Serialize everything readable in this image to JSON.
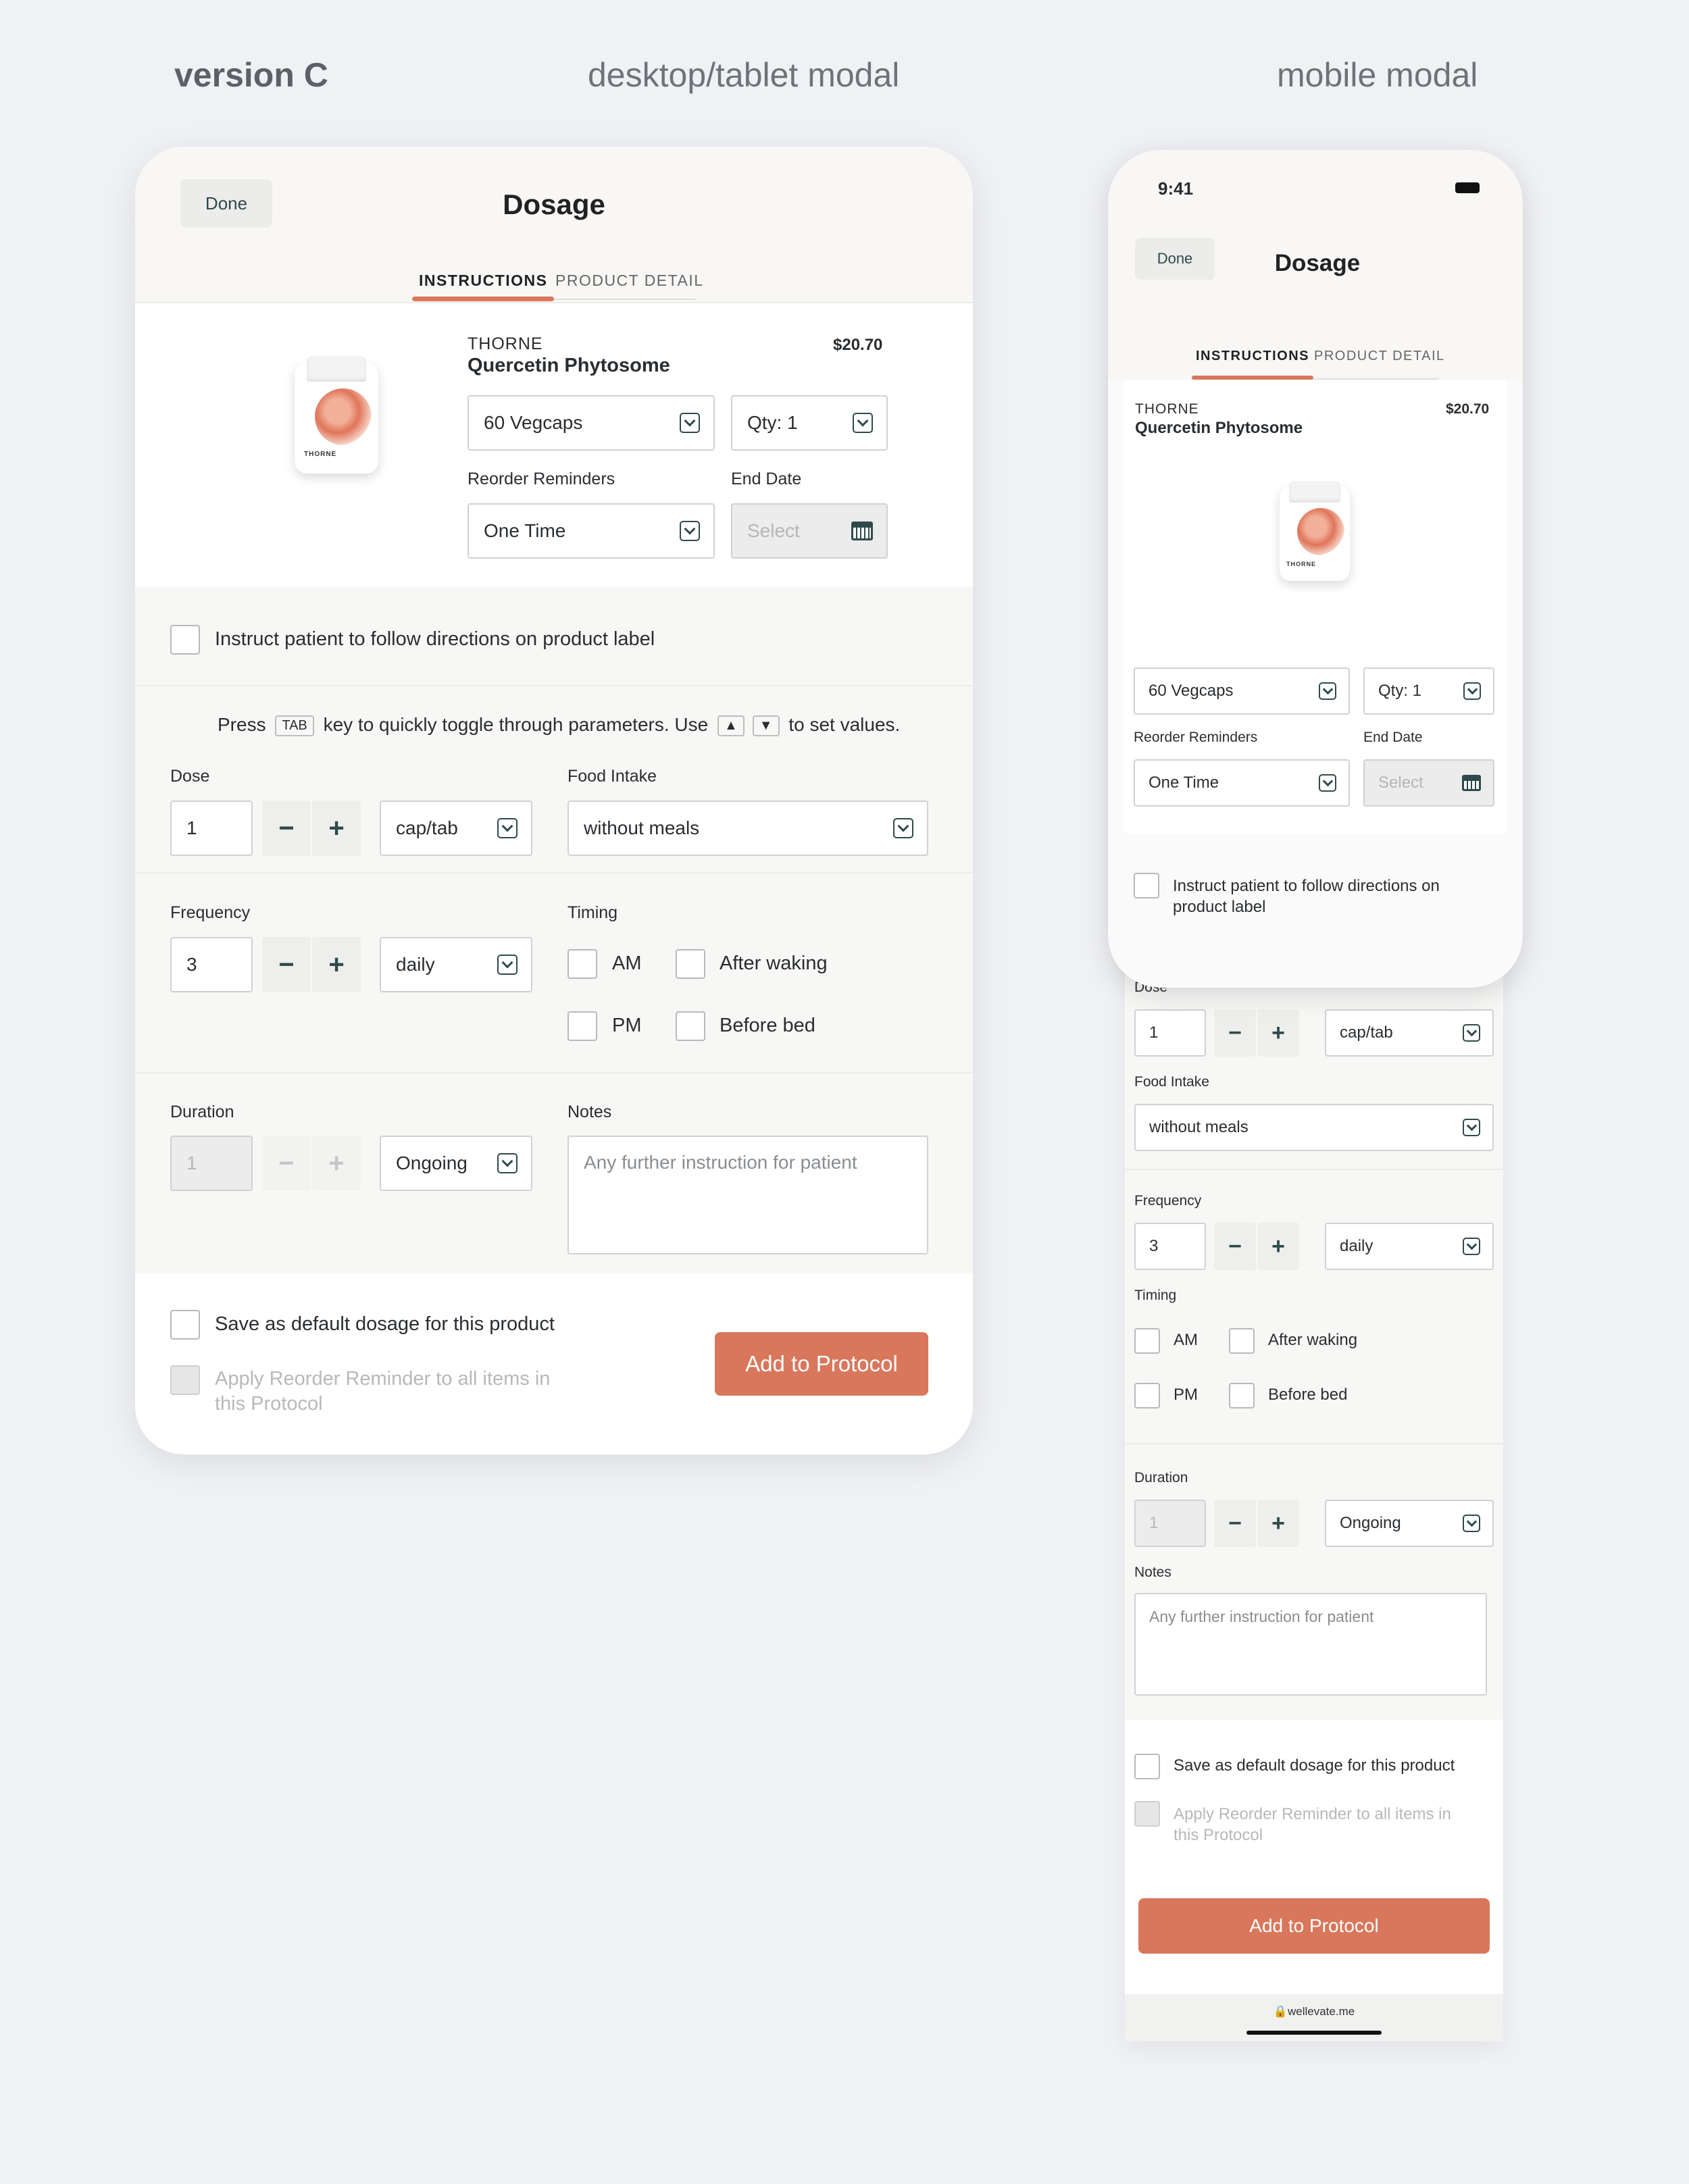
{
  "headers": {
    "version": "version C",
    "desktop": "desktop/tablet modal",
    "mobile": "mobile modal"
  },
  "desktop": {
    "done": "Done",
    "title": "Dosage",
    "tabs": [
      "INSTRUCTIONS",
      "PRODUCT DETAIL"
    ],
    "product": {
      "brand": "THORNE",
      "name": "Quercetin Phytosome",
      "price": "$20.70",
      "bottle_brand": "THORNE"
    },
    "size_select": "60 Vegcaps",
    "qty_select": "Qty: 1",
    "reorder_label": "Reorder Reminders",
    "reorder_value": "One Time",
    "end_label": "End Date",
    "end_placeholder": "Select",
    "follow_label": "Instruct patient to follow directions on product label",
    "hint": {
      "press": "Press",
      "tab": "TAB",
      "mid": "key to quickly toggle through parameters. Use",
      "up": "▲",
      "down": "▼",
      "end": "to set values."
    },
    "dose_label": "Dose",
    "dose_value": "1",
    "dose_unit": "cap/tab",
    "food_label": "Food Intake",
    "food_value": "without meals",
    "freq_label": "Frequency",
    "freq_value": "3",
    "freq_unit": "daily",
    "timing_label": "Timing",
    "timing": [
      "AM",
      "After waking",
      "PM",
      "Before bed"
    ],
    "duration_label": "Duration",
    "duration_value": "1",
    "duration_unit": "Ongoing",
    "notes_label": "Notes",
    "notes_placeholder": "Any further instruction for patient",
    "save_default": "Save as default dosage for this product",
    "apply_reminder": "Apply Reorder Reminder to all items in this Protocol",
    "cta": "Add to Protocol",
    "minus": "−",
    "plus": "+"
  },
  "mobile": {
    "time": "9:41",
    "done": "Done",
    "title": "Dosage",
    "tabs": [
      "INSTRUCTIONS",
      "PRODUCT DETAIL"
    ],
    "brand": "THORNE",
    "name": "Quercetin Phytosome",
    "price": "$20.70",
    "size_select": "60 Vegcaps",
    "qty_select": "Qty: 1",
    "reorder_label": "Reorder Reminders",
    "reorder_value": "One Time",
    "end_label": "End Date",
    "end_placeholder": "Select",
    "follow_label": "Instruct patient to follow directions on product label",
    "dose_label": "Dose",
    "dose_value": "1",
    "dose_unit": "cap/tab",
    "food_label": "Food Intake",
    "food_value": "without meals",
    "freq_label": "Frequency",
    "freq_value": "3",
    "freq_unit": "daily",
    "timing_label": "Timing",
    "timing": [
      "AM",
      "After waking",
      "PM",
      "Before bed"
    ],
    "duration_label": "Duration",
    "duration_value": "1",
    "duration_unit": "Ongoing",
    "notes_label": "Notes",
    "notes_placeholder": "Any further instruction for patient",
    "save_default": "Save as default dosage for this product",
    "apply_reminder": "Apply Reorder Reminder to all items in this Protocol",
    "cta": "Add to Protocol",
    "url": "wellevate.me",
    "minus": "−",
    "plus": "+"
  },
  "colors": {
    "accent": "#d9775c",
    "icon": "#2f4a4a",
    "background": "#f0f1f4"
  }
}
